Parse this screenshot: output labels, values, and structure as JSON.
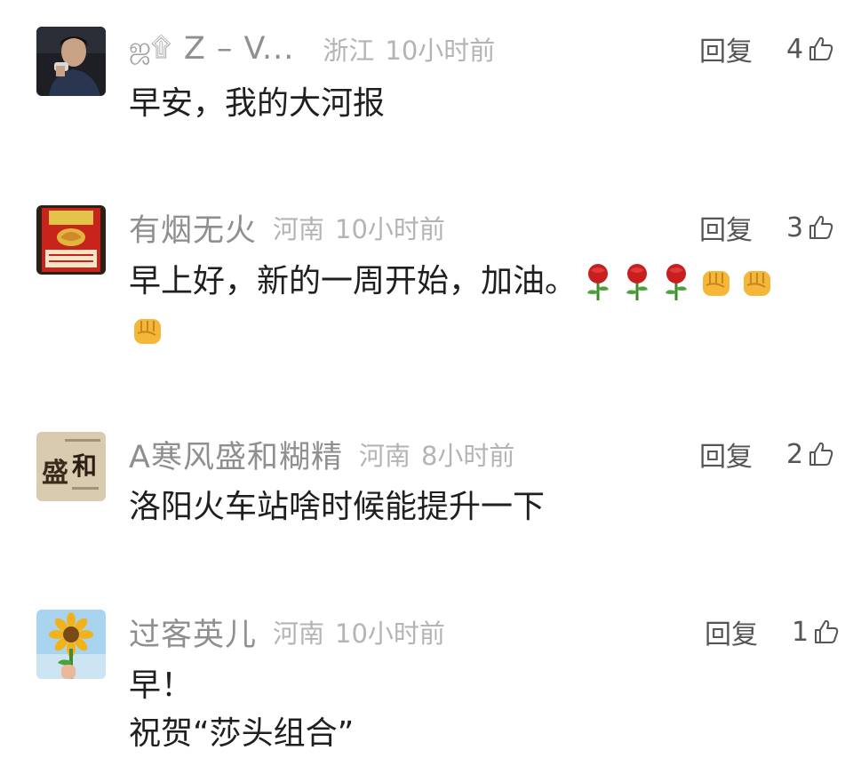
{
  "comments": [
    {
      "username": "Z – V...",
      "username_deco": "ஜ۩",
      "location": "浙江",
      "time": "10小时前",
      "reply_label": "回复",
      "likes": "4",
      "lines": [
        "早安，我的大河报"
      ],
      "avatar_icon": "man-portrait-avatar"
    },
    {
      "username": "有烟无火",
      "location": "河南",
      "time": "10小时前",
      "reply_label": "回复",
      "likes": "3",
      "lines": [
        "早上好，新的一周开始，加油。"
      ],
      "emojis": [
        "rose",
        "rose",
        "rose",
        "fist",
        "fist",
        "fist"
      ],
      "avatar_icon": "cigarette-pack-avatar"
    },
    {
      "username": "A寒风盛和糊精",
      "location": "河南",
      "time": "8小时前",
      "reply_label": "回复",
      "likes": "2",
      "lines": [
        "洛阳火车站啥时候能提升一下"
      ],
      "avatar_text": "盛和",
      "avatar_icon": "calligraphy-avatar"
    },
    {
      "username": "过客英儿",
      "location": "河南",
      "time": "10小时前",
      "reply_label": "回复",
      "likes": "1",
      "lines": [
        "早！",
        "祝贺“莎头组合”"
      ],
      "avatar_icon": "sunflower-avatar"
    }
  ],
  "colors": {
    "username": "#8f8f8f",
    "meta": "#b4b4b4",
    "text": "#1f1f1f",
    "action": "#555555"
  }
}
